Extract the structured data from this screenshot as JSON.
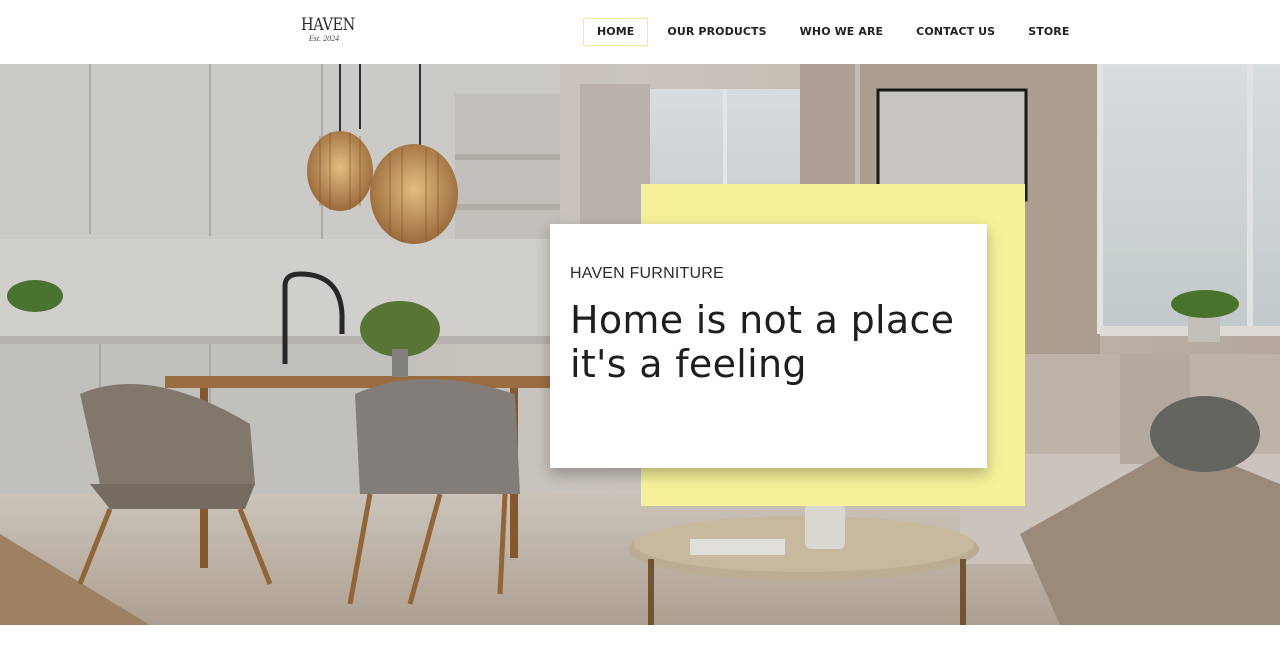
{
  "header": {
    "logo_word": "HAVEN",
    "logo_est": "Est. 2024"
  },
  "nav": {
    "items": [
      {
        "label": "HOME",
        "active": true
      },
      {
        "label": "OUR PRODUCTS",
        "active": false
      },
      {
        "label": "WHO WE ARE",
        "active": false
      },
      {
        "label": "CONTACT US",
        "active": false
      },
      {
        "label": "STORE",
        "active": false
      }
    ]
  },
  "hero": {
    "eyebrow": "HAVEN FURNITURE",
    "title": "Home is not a place it's a feeling",
    "accent_color": "#f6f19a"
  }
}
